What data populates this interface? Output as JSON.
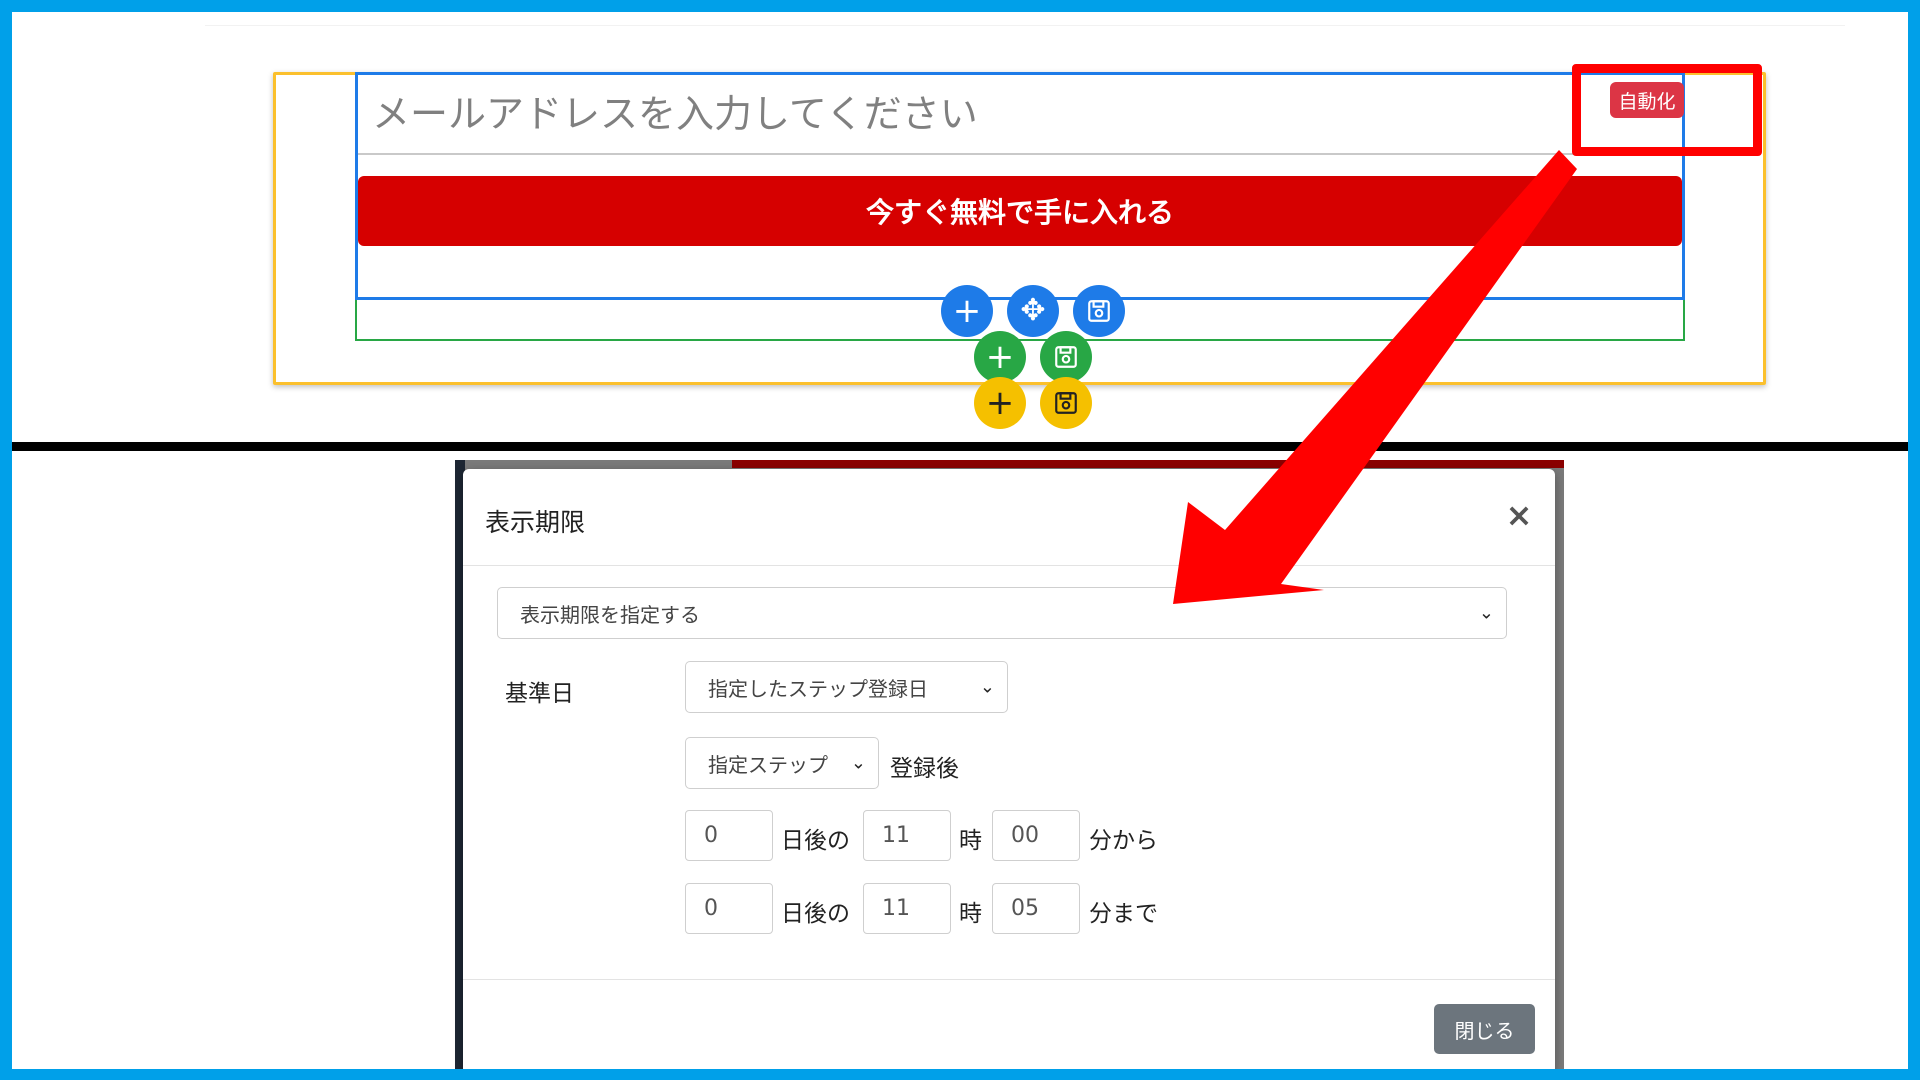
{
  "editor": {
    "email_placeholder": "メールアドレスを入力してください",
    "cta_label": "今すぐ無料で手に入れる",
    "auto_badge": "自動化",
    "controls": {
      "blue_add": "+",
      "blue_move": "✥",
      "green_add": "+",
      "yellow_add": "+"
    }
  },
  "modal": {
    "title": "表示期限",
    "close_icon": "×",
    "mode_select": "表示期限を指定する",
    "base_date_label": "基準日",
    "base_date_select": "指定したステップ登録日",
    "step_select": "指定ステップ",
    "after_registration": "登録後",
    "from_row": {
      "days": "0",
      "days_label": "日後の",
      "hour": "11",
      "hour_label": "時",
      "minute": "00",
      "minute_label": "分から"
    },
    "to_row": {
      "days": "0",
      "days_label": "日後の",
      "hour": "11",
      "hour_label": "時",
      "minute": "05",
      "minute_label": "分まで"
    },
    "close_button": "閉じる"
  },
  "colors": {
    "frame": "#00a0e9",
    "cta": "#d60000",
    "badge": "#dc3545",
    "highlight": "#ff0000",
    "blue": "#1e7be8",
    "green": "#28a745",
    "yellow": "#f5c000"
  }
}
